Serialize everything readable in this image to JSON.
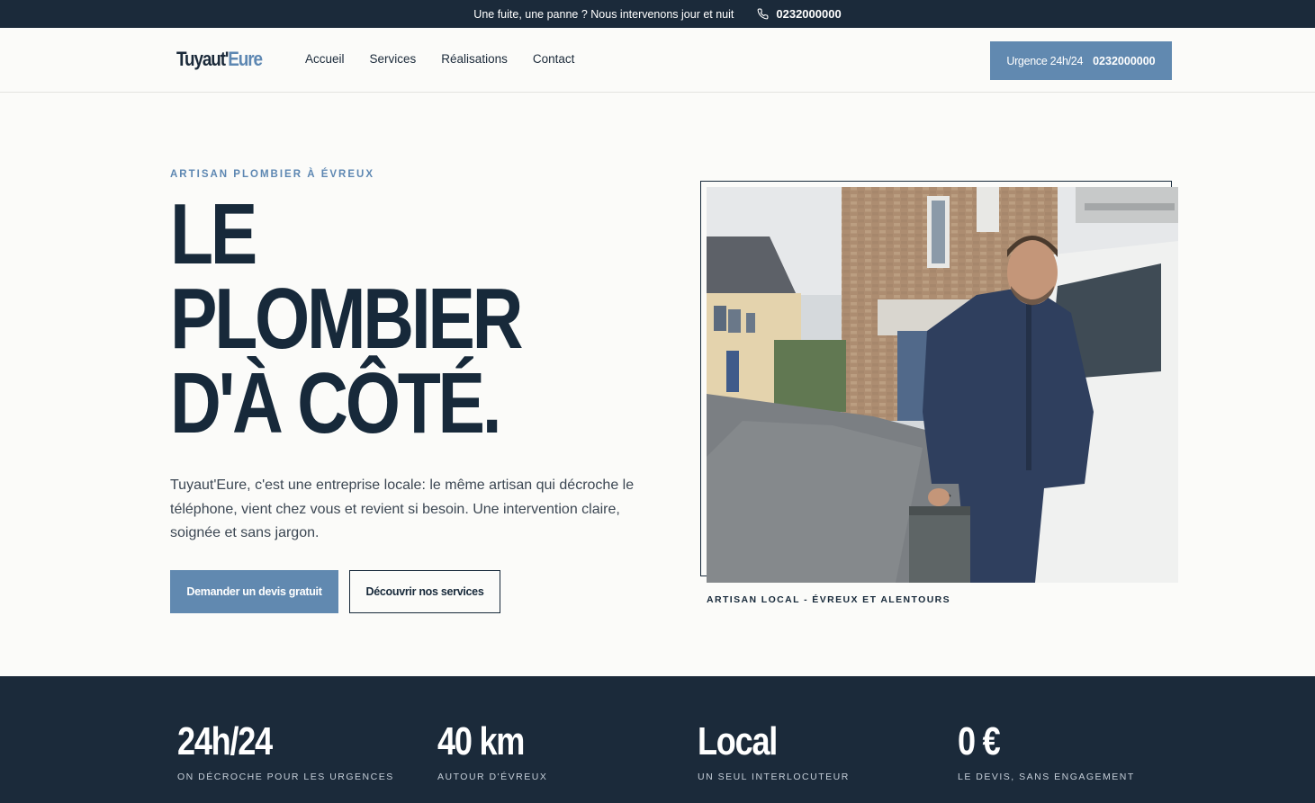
{
  "topbar": {
    "message": "Une fuite, une panne ? Nous intervenons jour et nuit",
    "phone": "0232000000",
    "phone_icon": "phone-icon"
  },
  "header": {
    "logo_main": "Tuyaut'",
    "logo_accent": "Eure",
    "nav": [
      "Accueil",
      "Services",
      "Réalisations",
      "Contact"
    ],
    "urgent_label": "Urgence 24h/24",
    "urgent_phone": "0232000000"
  },
  "hero": {
    "eyebrow": "ARTISAN PLOMBIER À ÉVREUX",
    "title_line1": "LE",
    "title_line2": "PLOMBIER",
    "title_line3": "D'À CÔTÉ.",
    "text": "Tuyaut'Eure, c'est une entreprise locale: le même artisan qui décroche le téléphone, vient chez vous et revient si besoin. Une intervention claire, soignée et sans jargon.",
    "cta_primary": "Demander un devis gratuit",
    "cta_secondary": "Découvrir nos services",
    "photo_caption": "ARTISAN LOCAL - ÉVREUX ET ALENTOURS"
  },
  "stats": [
    {
      "value": "24h/24",
      "label": "ON DÉCROCHE POUR LES URGENCES"
    },
    {
      "value": "40 km",
      "label": "AUTOUR D'ÉVREUX"
    },
    {
      "value": "Local",
      "label": "UN SEUL INTERLOCUTEUR"
    },
    {
      "value": "0 €",
      "label": "LE DEVIS, SANS ENGAGEMENT"
    }
  ],
  "colors": {
    "navy": "#1b2a3a",
    "accent": "#6189b0",
    "background": "#fbfbf9"
  }
}
